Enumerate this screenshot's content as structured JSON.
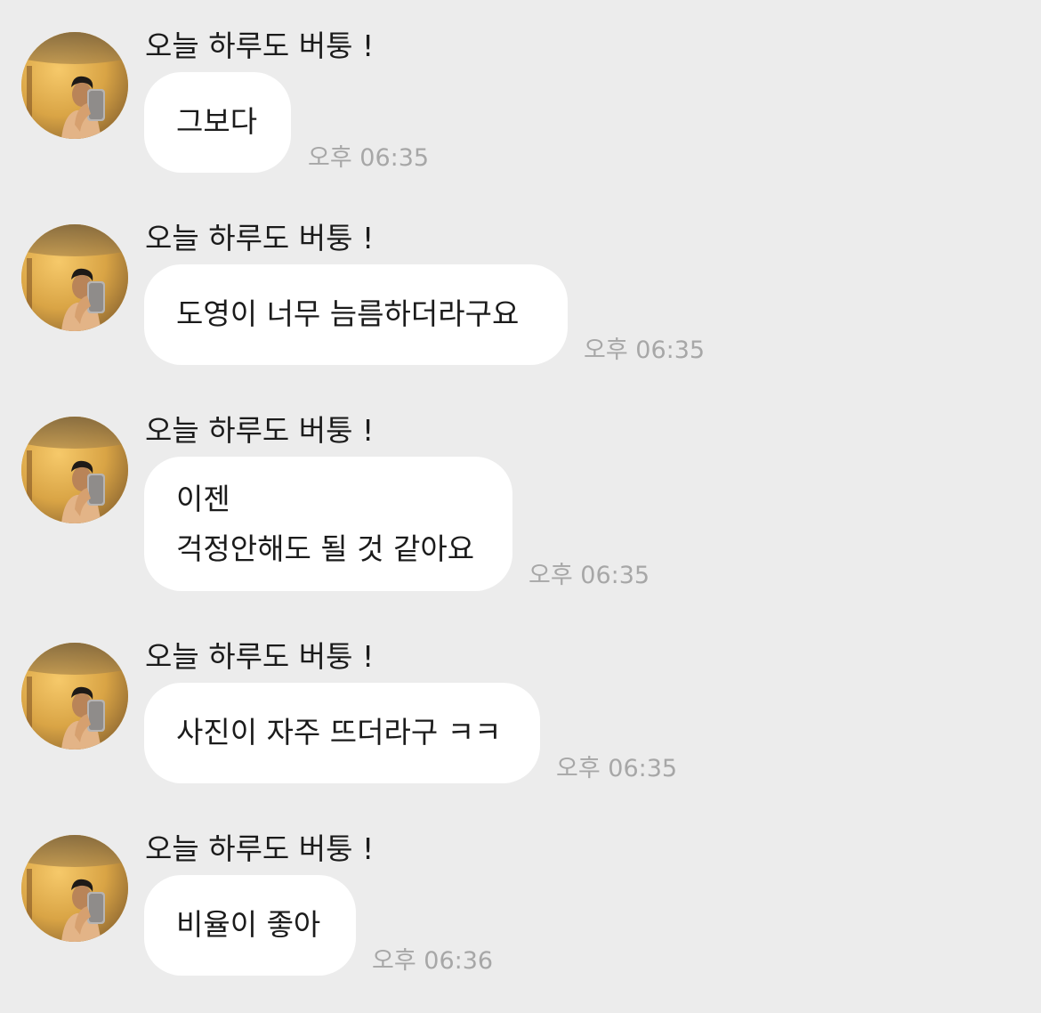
{
  "sender_name": "오늘 하루도 버퉁 !",
  "messages": [
    {
      "lines": [
        "그보다"
      ],
      "time": "오후 06:35"
    },
    {
      "lines": [
        "도영이 너무 늠름하더라구요"
      ],
      "time": "오후 06:35"
    },
    {
      "lines": [
        "이젠",
        "걱정안해도 될 것 같아요"
      ],
      "time": "오후 06:35"
    },
    {
      "lines": [
        "사진이 자주 뜨더라구 ㅋㅋ"
      ],
      "time": "오후 06:35"
    },
    {
      "lines": [
        "비율이 좋아"
      ],
      "time": "오후 06:36"
    }
  ]
}
